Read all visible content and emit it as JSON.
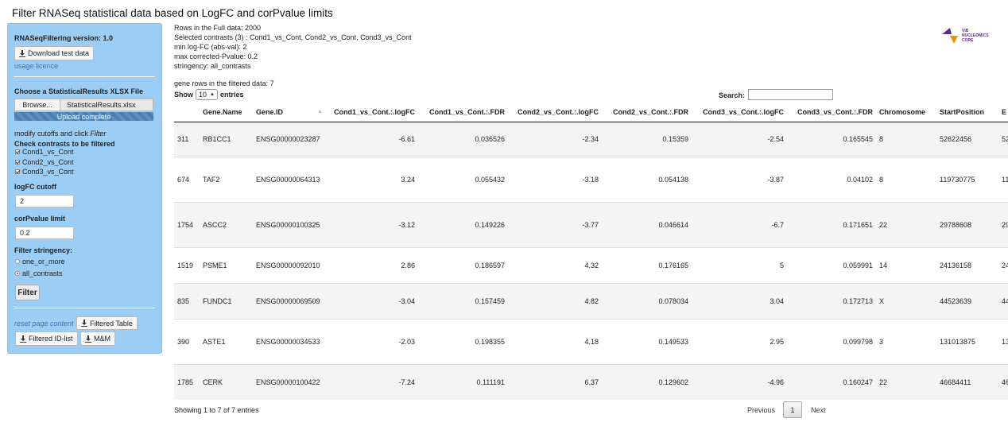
{
  "page": {
    "title": "Filter RNASeq statistical data based on LogFC and corPvalue limits"
  },
  "sidebar": {
    "version": "RNASeqFiltering version: 1.0",
    "download_test_data": "Download test data",
    "usage_licence": "usage licence",
    "choose_file_label": "Choose a StatisticalResults XLSX File",
    "browse_label": "Browse...",
    "file_name": "StatisticalResults.xlsx",
    "upload_status": "Upload complete",
    "modify_cutoffs": "modify cutoffs and click ",
    "modify_cutoffs_emph": "Filter",
    "check_contrasts_label": "Check contrasts to be filtered",
    "contrasts": [
      {
        "label": "Cond1_vs_Cont",
        "checked": true
      },
      {
        "label": "Cond2_vs_Cont",
        "checked": true
      },
      {
        "label": "Cond3_vs_Cont",
        "checked": true
      }
    ],
    "logfc_label": "logFC cutoff",
    "logfc_value": "2",
    "corp_label": "corPvalue limit",
    "corp_value": "0.2",
    "stringency_label": "Filter stringency:",
    "stringency_options": [
      {
        "label": "one_or_more",
        "selected": false
      },
      {
        "label": "all_contrasts",
        "selected": true
      }
    ],
    "filter_button": "Filter",
    "reset_page": "reset page content",
    "filtered_table_button": "Filtered Table",
    "filtered_idlist_button": "Filtered ID-list",
    "mm_button": "M&M"
  },
  "info": {
    "lines": [
      "Rows in the Full data: 2000",
      "Selected contrasts (3) : Cond1_vs_Cont, Cond2_vs_Cont, Cond3_vs_Cont",
      "min log-FC (abs-val): 2",
      "max corrected-Pvalue: 0.2",
      "stringency: all_contrasts"
    ],
    "gene_rows": "gene rows in the filtered data: 7"
  },
  "logo": {
    "line1": "VIB",
    "line2": "NUCLEOMICS",
    "line3": "CORE",
    "color_purple": "#5a2d82",
    "color_orange": "#f39200"
  },
  "table": {
    "show_label": "Show",
    "entries_label": "entries",
    "page_length": "10",
    "search_label": "Search:",
    "search_value": "",
    "columns": [
      "",
      "Gene.Name",
      "Gene.ID",
      "Cond1_vs_Cont.:.logFC",
      "Cond1_vs_Cont.:.FDR",
      "Cond2_vs_Cont.:.logFC",
      "Cond2_vs_Cont.:.FDR",
      "Cond3_vs_Cont.:.logFC",
      "Cond3_vs_Cont.:.FDR",
      "Chromosome",
      "StartPosition",
      "E"
    ],
    "rows": [
      [
        "311",
        "RB1CC1",
        "ENSG00000023287",
        "-6.61",
        "0.036526",
        "-2.34",
        "0.15359",
        "-2.54",
        "0.165545",
        "8",
        "52622456",
        "52"
      ],
      [
        "674",
        "TAF2",
        "ENSG00000064313",
        "3.24",
        "0.055432",
        "-3.18",
        "0.054138",
        "-3.87",
        "0.04102",
        "8",
        "119730775",
        "11"
      ],
      [
        "1754",
        "ASCC2",
        "ENSG00000100325",
        "-3.12",
        "0.149226",
        "-3.77",
        "0.046614",
        "-6.7",
        "0.171651",
        "22",
        "29788608",
        "29"
      ],
      [
        "1519",
        "PSME1",
        "ENSG00000092010",
        "2.86",
        "0.186597",
        "4.32",
        "0.176165",
        "5",
        "0.059991",
        "14",
        "24136158",
        "24"
      ],
      [
        "835",
        "FUNDC1",
        "ENSG00000069509",
        "-3.04",
        "0.157459",
        "4.82",
        "0.078034",
        "3.04",
        "0.172713",
        "X",
        "44523639",
        "44"
      ],
      [
        "390",
        "ASTE1",
        "ENSG00000034533",
        "-2.03",
        "0.198355",
        "4.18",
        "0.149533",
        "2.95",
        "0.099798",
        "3",
        "131013875",
        "13"
      ],
      [
        "1785",
        "CERK",
        "ENSG00000100422",
        "-7.24",
        "0.111191",
        "6.37",
        "0.129602",
        "-4.96",
        "0.160247",
        "22",
        "46684411",
        "46"
      ]
    ],
    "footer_info": "Showing 1 to 7 of 7 entries",
    "prev_label": "Previous",
    "current_page": "1",
    "next_label": "Next"
  }
}
